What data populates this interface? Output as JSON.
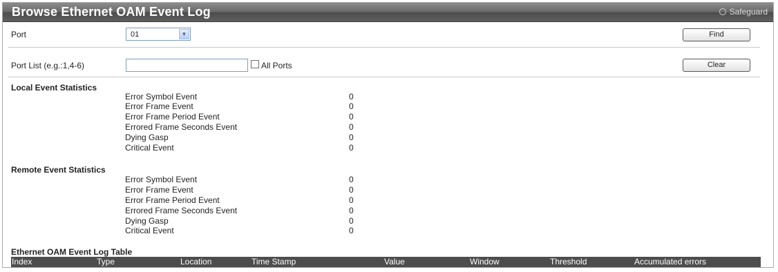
{
  "header": {
    "title": "Browse Ethernet OAM Event Log",
    "safeguard": "Safeguard"
  },
  "port": {
    "label": "Port",
    "value": "01",
    "find_label": "Find"
  },
  "port_list": {
    "label": "Port List (e.g.:1,4-6)",
    "value": "",
    "all_ports_label": "All Ports",
    "clear_label": "Clear"
  },
  "local": {
    "title": "Local Event Statistics",
    "items": [
      {
        "label": "Error Symbol Event",
        "value": "0"
      },
      {
        "label": "Error Frame Event",
        "value": "0"
      },
      {
        "label": "Error Frame Period Event",
        "value": "0"
      },
      {
        "label": "Errored Frame Seconds Event",
        "value": "0"
      },
      {
        "label": "Dying Gasp",
        "value": "0"
      },
      {
        "label": "Critical Event",
        "value": "0"
      }
    ]
  },
  "remote": {
    "title": "Remote Event Statistics",
    "items": [
      {
        "label": "Error Symbol Event",
        "value": "0"
      },
      {
        "label": "Error Frame Event",
        "value": "0"
      },
      {
        "label": "Error Frame Period Event",
        "value": "0"
      },
      {
        "label": "Errored Frame Seconds Event",
        "value": "0"
      },
      {
        "label": "Dying Gasp",
        "value": "0"
      },
      {
        "label": "Critical Event",
        "value": "0"
      }
    ]
  },
  "log_table": {
    "title": "Ethernet OAM Event Log Table",
    "columns": [
      "Index",
      "Type",
      "Location",
      "Time Stamp",
      "Value",
      "Window",
      "Threshold",
      "Accumulated errors"
    ]
  }
}
